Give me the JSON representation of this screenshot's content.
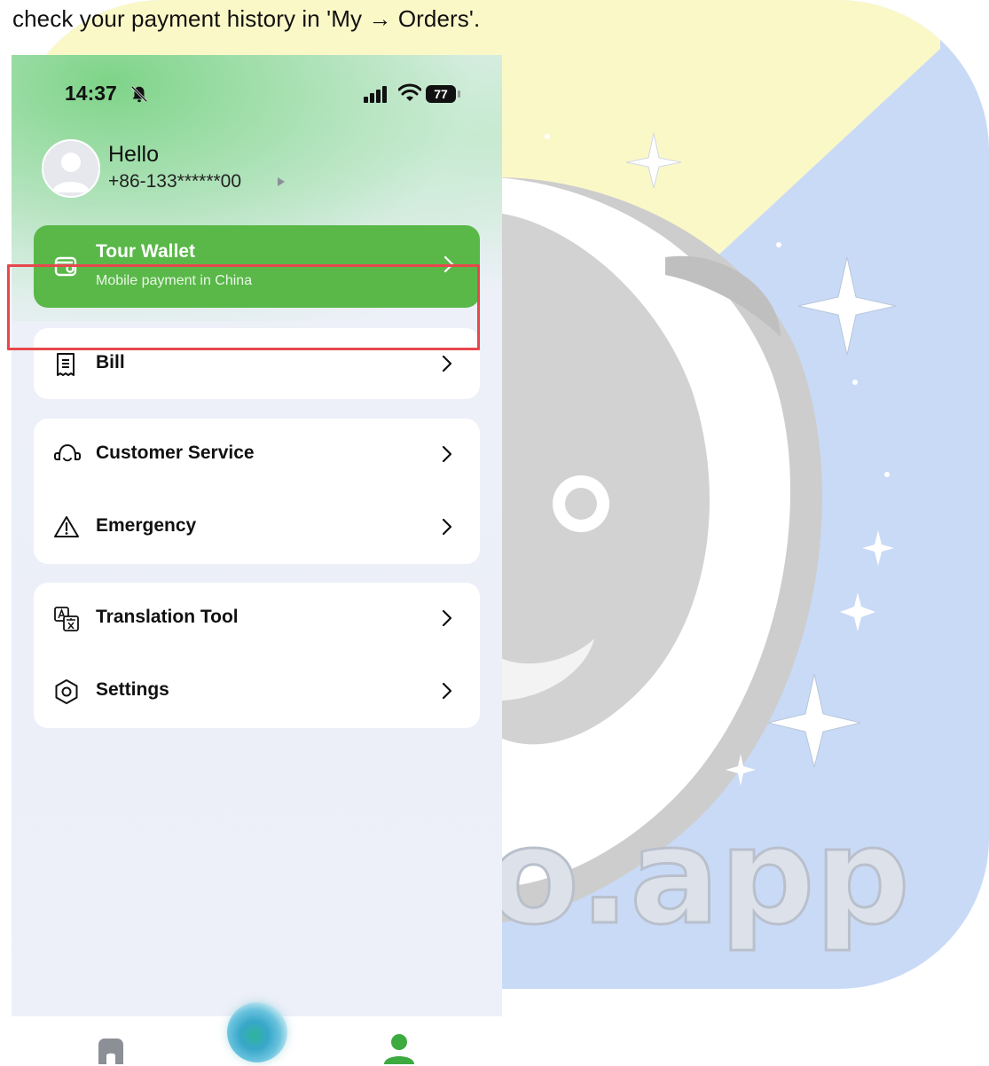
{
  "caption": "check your payment history in 'My → Orders'.",
  "status_bar": {
    "time": "14:37",
    "battery": "77"
  },
  "profile": {
    "greeting": "Hello",
    "phone": "+86-133******00"
  },
  "wallet": {
    "title": "Tour Wallet",
    "subtitle": "Mobile payment in China"
  },
  "menu_groups": [
    {
      "items": [
        {
          "label": "Bill",
          "icon": "receipt-icon"
        }
      ]
    },
    {
      "items": [
        {
          "label": "Customer Service",
          "icon": "headset-icon"
        },
        {
          "label": "Emergency",
          "icon": "warning-icon"
        }
      ]
    },
    {
      "items": [
        {
          "label": "Translation Tool",
          "icon": "translate-icon"
        },
        {
          "label": "Settings",
          "icon": "settings-icon"
        }
      ]
    }
  ],
  "background_watermark": "o.app",
  "bottom_nav": [
    "home-icon",
    "ai-assistant-icon",
    "profile-icon"
  ],
  "colors": {
    "accent": "#59b848",
    "highlight": "#e8474e"
  }
}
